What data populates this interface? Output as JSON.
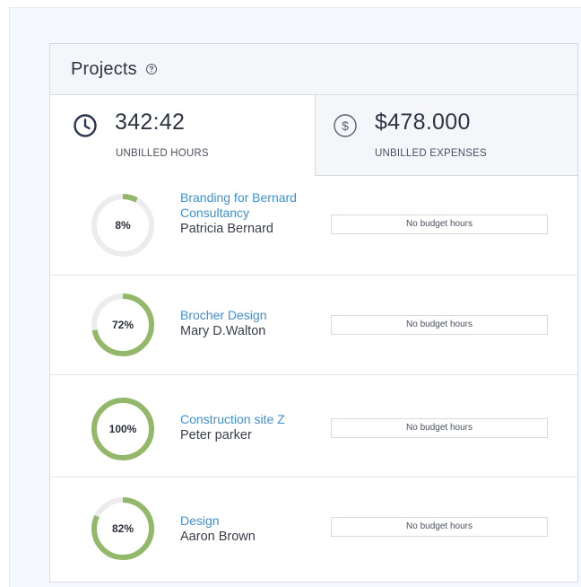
{
  "panel": {
    "title": "Projects",
    "help_icon": "question-circle-icon"
  },
  "stats": {
    "hours": {
      "icon": "clock-icon",
      "value": "342:42",
      "label": "UNBILLED HOURS"
    },
    "expenses": {
      "icon": "dollar-circle-icon",
      "value": "$478.000",
      "label": "UNBILLED EXPENSES"
    }
  },
  "colors": {
    "progress": "#93b86a",
    "track": "#ececec",
    "link": "#3f8fd2",
    "text": "#2e3542"
  },
  "projects": [
    {
      "percent_label": "8%",
      "progress": 0.08,
      "name": "Branding for Bernard Consultancy",
      "client": "Patricia Bernard",
      "budget": "No budget hours"
    },
    {
      "percent_label": "72%",
      "progress": 0.72,
      "name": "Brocher Design",
      "client": "Mary D.Walton",
      "budget": "No budget hours"
    },
    {
      "percent_label": "100%",
      "progress": 1.0,
      "name": "Construction site Z",
      "client": "Peter parker",
      "budget": "No budget hours"
    },
    {
      "percent_label": "82%",
      "progress": 0.82,
      "name": "Design",
      "client": "Aaron Brown",
      "budget": "No budget hours"
    }
  ]
}
